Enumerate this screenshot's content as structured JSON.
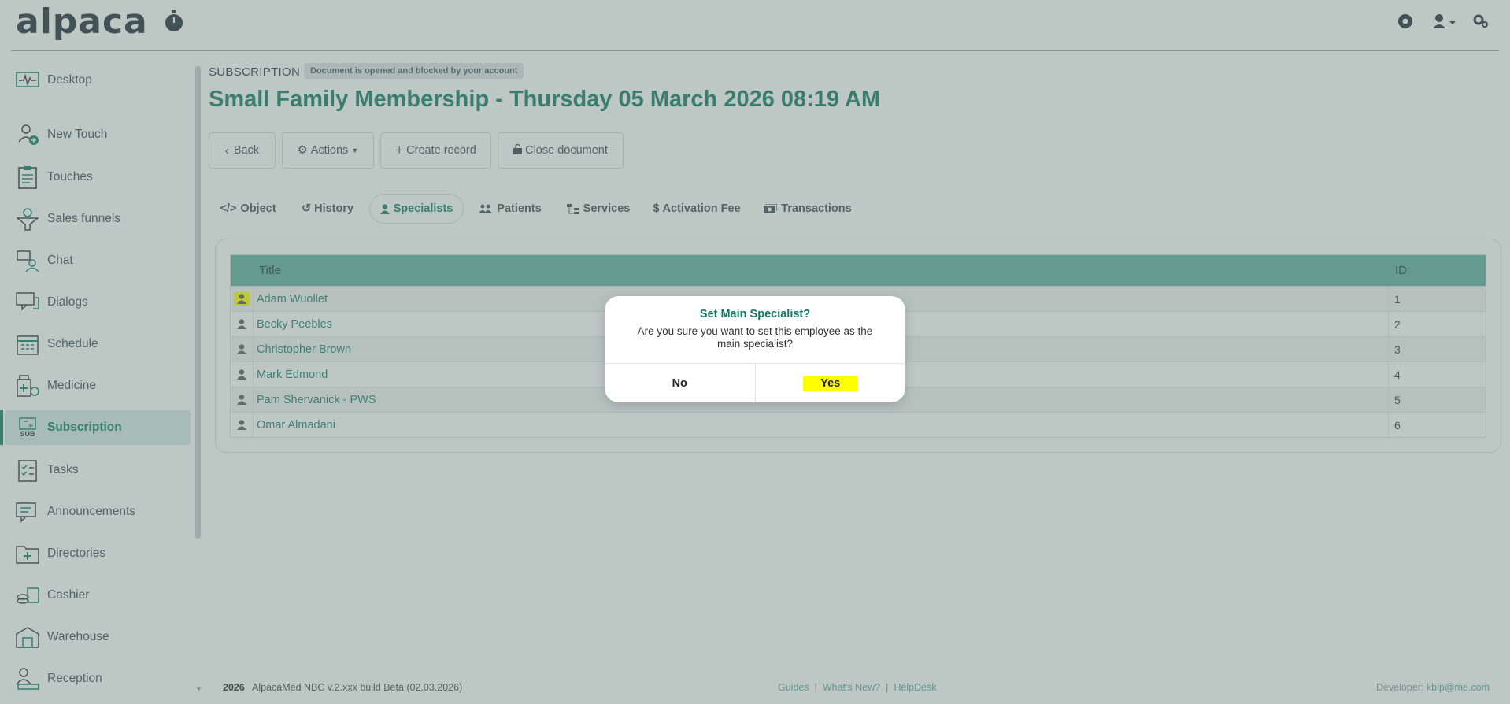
{
  "header": {
    "logo": "alpaca"
  },
  "sidebar": {
    "items": [
      {
        "label": "Desktop",
        "icon": "pulse-monitor-icon"
      },
      {
        "label": "New Touch",
        "icon": "new-touch-icon"
      },
      {
        "label": "Touches",
        "icon": "clipboard-icon"
      },
      {
        "label": "Sales funnels",
        "icon": "funnel-icon"
      },
      {
        "label": "Chat",
        "icon": "chat-icon"
      },
      {
        "label": "Dialogs",
        "icon": "dialogs-icon"
      },
      {
        "label": "Schedule",
        "icon": "calendar-icon"
      },
      {
        "label": "Medicine",
        "icon": "medicine-icon"
      },
      {
        "label": "Subscription",
        "icon": "subscription-icon",
        "icon_text": "SUB",
        "active": true
      },
      {
        "label": "Tasks",
        "icon": "tasks-checklist-icon"
      },
      {
        "label": "Announcements",
        "icon": "announcements-icon"
      },
      {
        "label": "Directories",
        "icon": "folder-plus-icon"
      },
      {
        "label": "Cashier",
        "icon": "cash-stack-icon"
      },
      {
        "label": "Warehouse",
        "icon": "warehouse-icon"
      },
      {
        "label": "Reception",
        "icon": "reception-icon"
      }
    ]
  },
  "document": {
    "kind": "SUBSCRIPTION",
    "lock_status": "Document is opened and blocked by your account",
    "title": "Small Family Membership - Thursday 05 March 2026 08:19 AM"
  },
  "toolbar": {
    "back_label": "Back",
    "actions_label": "Actions",
    "create_label": "Create record",
    "close_label": "Close document"
  },
  "tabs": [
    {
      "label": "Object",
      "icon": "code-icon"
    },
    {
      "label": "History",
      "icon": "history-icon"
    },
    {
      "label": "Specialists",
      "icon": "specialist-icon",
      "active": true
    },
    {
      "label": "Patients",
      "icon": "users-icon"
    },
    {
      "label": "Services",
      "icon": "sitemap-icon"
    },
    {
      "label": "Activation Fee",
      "icon": "dollar-icon"
    },
    {
      "label": "Transactions",
      "icon": "money-icon"
    }
  ],
  "table": {
    "columns": [
      "Title",
      "ID"
    ],
    "rows": [
      {
        "title": "Adam Wuollet",
        "id": "1"
      },
      {
        "title": "Becky Peebles",
        "id": "2"
      },
      {
        "title": "Christopher Brown",
        "id": "3"
      },
      {
        "title": "Mark Edmond",
        "id": "4"
      },
      {
        "title": "Pam Shervanick - PWS",
        "id": "5"
      },
      {
        "title": "Omar Almadani",
        "id": "6"
      }
    ]
  },
  "modal": {
    "title": "Set Main Specialist?",
    "text": "Are you sure you want to set this employee as the main specialist?",
    "no_label": "No",
    "yes_label": "Yes"
  },
  "footer": {
    "year": "2026",
    "version": "AlpacaMed NBC v.2.xxx build Beta (02.03.2026)",
    "links": [
      "Guides",
      "What's New?",
      "HelpDesk"
    ],
    "developer_label": "Developer:",
    "developer_email": "kblp@me.com"
  },
  "colors": {
    "accent": "#117a65",
    "table_header": "#5fae9e",
    "highlight": "#ffff00"
  }
}
